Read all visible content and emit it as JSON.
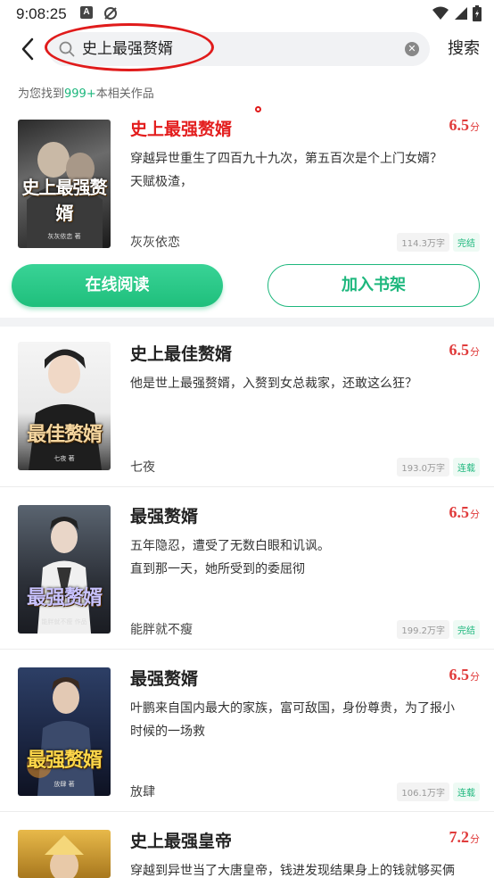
{
  "status_bar": {
    "time": "9:08:25",
    "icon_a": "A"
  },
  "header": {
    "search_value": "史上最强赘婿",
    "search_button": "搜索"
  },
  "result": {
    "prefix": "为您找到",
    "count": "999+",
    "suffix": "本相关作品"
  },
  "actions": {
    "read_online": "在线阅读",
    "add_to_shelf": "加入书架"
  },
  "books": [
    {
      "title": "史上最强赘婿",
      "score": "6.5",
      "score_unit": "分",
      "desc": [
        "穿越异世重生了四百九十九次，第五百次是个上门女婿？",
        "天赋极渣，"
      ],
      "author": "灰灰依恋",
      "words": "114.3万字",
      "status": "完结",
      "cover_text": "史上最强赘婿",
      "cover_foot": "灰灰依恋 著"
    },
    {
      "title": "史上最佳赘婿",
      "score": "6.5",
      "score_unit": "分",
      "desc": [
        "他是世上最强赘婿，入赘到女总裁家，还敢这么狂？"
      ],
      "author": "七夜",
      "words": "193.0万字",
      "status": "连载",
      "cover_text": "最佳赘婿",
      "cover_foot": "七夜 著"
    },
    {
      "title": "最强赘婿",
      "score": "6.5",
      "score_unit": "分",
      "desc": [
        "五年隐忍，遭受了无数白眼和讥讽。",
        "直到那一天，她所受到的委屈彻"
      ],
      "author": "能胖就不瘦",
      "words": "199.2万字",
      "status": "完结",
      "cover_text": "最强赘婿",
      "cover_foot": "能胖就不瘦 作品"
    },
    {
      "title": "最强赘婿",
      "score": "6.5",
      "score_unit": "分",
      "desc": [
        "叶鹏来自国内最大的家族，富可敌国，身份尊贵，为了报小",
        "时候的一场救"
      ],
      "author": "放肆",
      "words": "106.1万字",
      "status": "连载",
      "cover_text": "最强赘婿",
      "cover_foot": "放肆 著"
    },
    {
      "title": "史上最强皇帝",
      "score": "7.2",
      "score_unit": "分",
      "desc": [
        "穿越到异世当了大唐皇帝，钱进发现结果身上的钱就够买俩"
      ],
      "author": "",
      "words": "",
      "status": "",
      "cover_text": "",
      "cover_foot": ""
    }
  ],
  "colors": {
    "accent_green": "#1db77d",
    "score_red": "#e03c3c",
    "title_red": "#e31d1d"
  }
}
